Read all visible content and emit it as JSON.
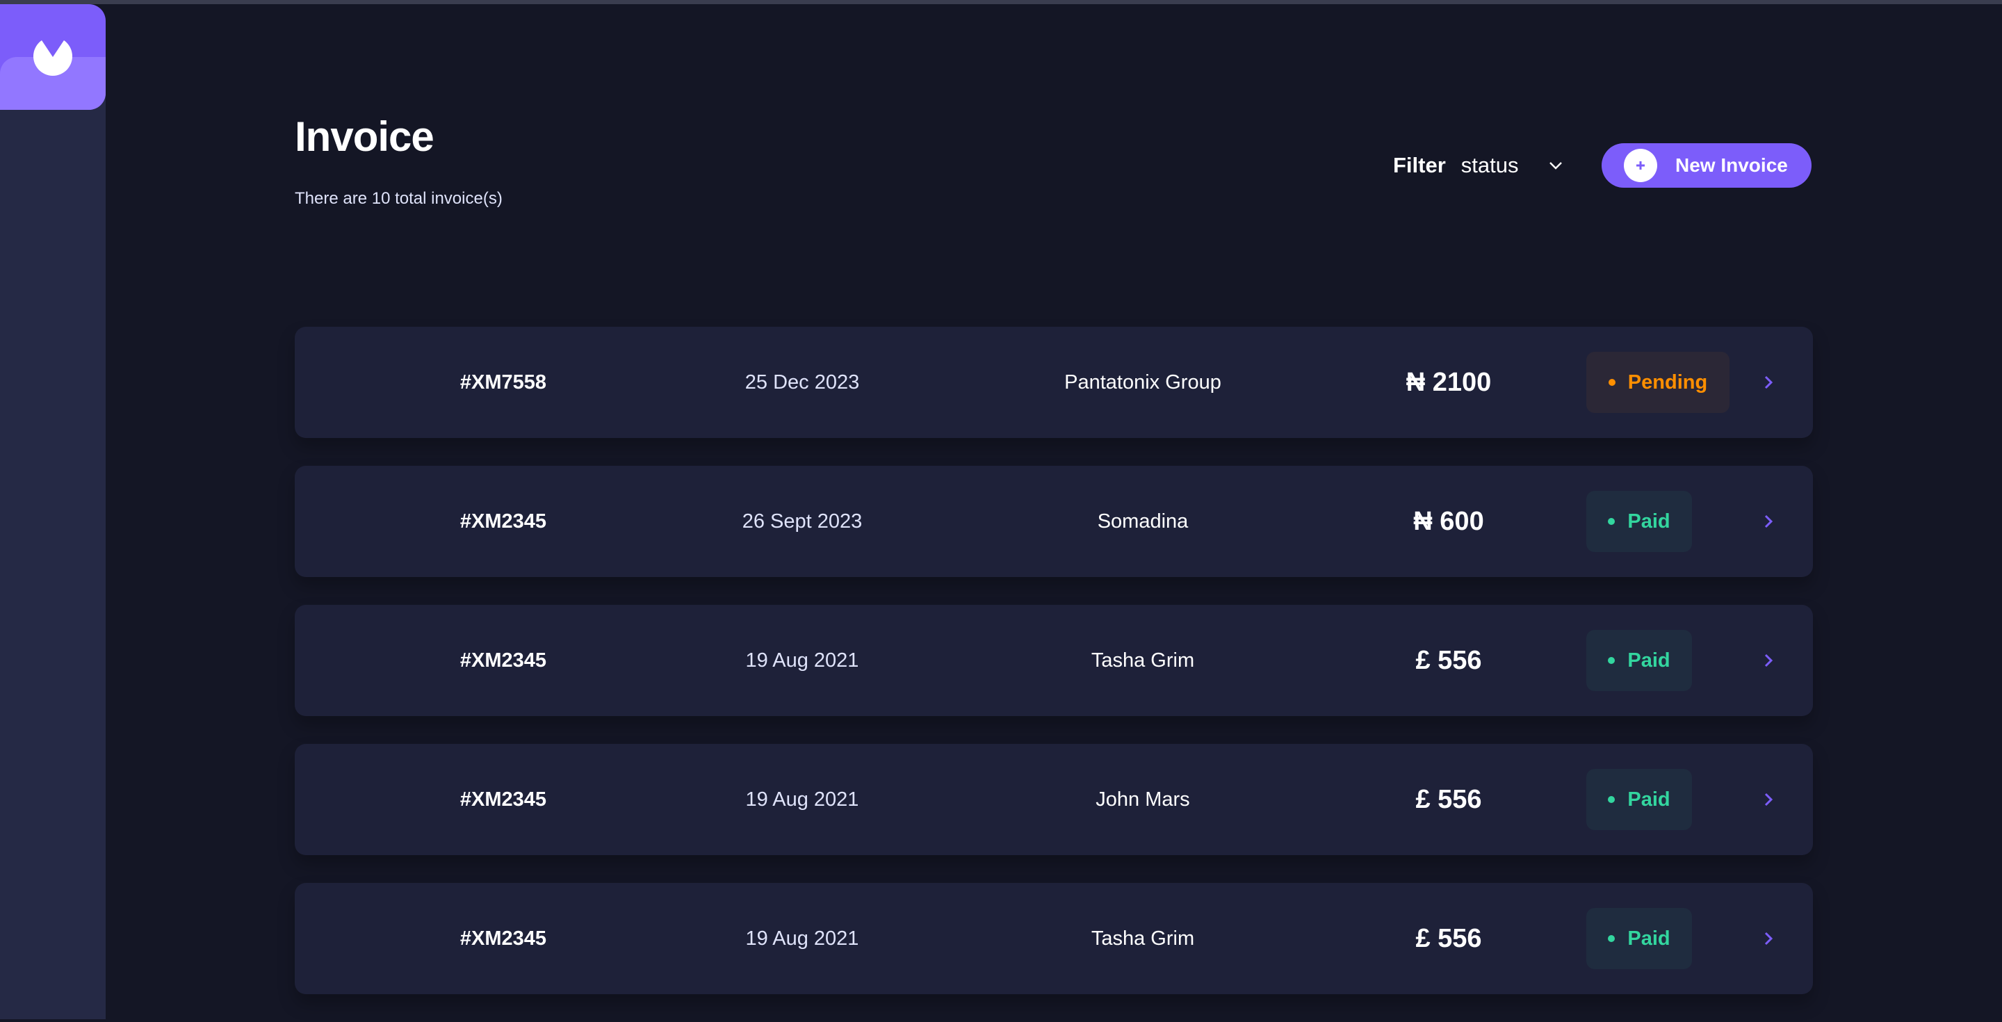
{
  "header": {
    "title": "Invoice",
    "subtitle": "There are 10 total invoice(s)"
  },
  "filter": {
    "label": "Filter",
    "value": "status"
  },
  "new_invoice": {
    "label": "New Invoice"
  },
  "colors": {
    "accent": "#7c5dfa",
    "pending": "#ff8f00",
    "paid": "#33d69f"
  },
  "invoices": [
    {
      "id": "#XM7558",
      "date": "25 Dec 2023",
      "client": "Pantatonix Group",
      "amount": "₦ 2100",
      "status": "Pending"
    },
    {
      "id": "#XM2345",
      "date": "26 Sept 2023",
      "client": "Somadina",
      "amount": "₦ 600",
      "status": "Paid"
    },
    {
      "id": "#XM2345",
      "date": "19 Aug 2021",
      "client": "Tasha Grim",
      "amount": "£ 556",
      "status": "Paid"
    },
    {
      "id": "#XM2345",
      "date": "19 Aug 2021",
      "client": "John Mars",
      "amount": "£ 556",
      "status": "Paid"
    },
    {
      "id": "#XM2345",
      "date": "19 Aug 2021",
      "client": "Tasha Grim",
      "amount": "£ 556",
      "status": "Paid"
    }
  ]
}
